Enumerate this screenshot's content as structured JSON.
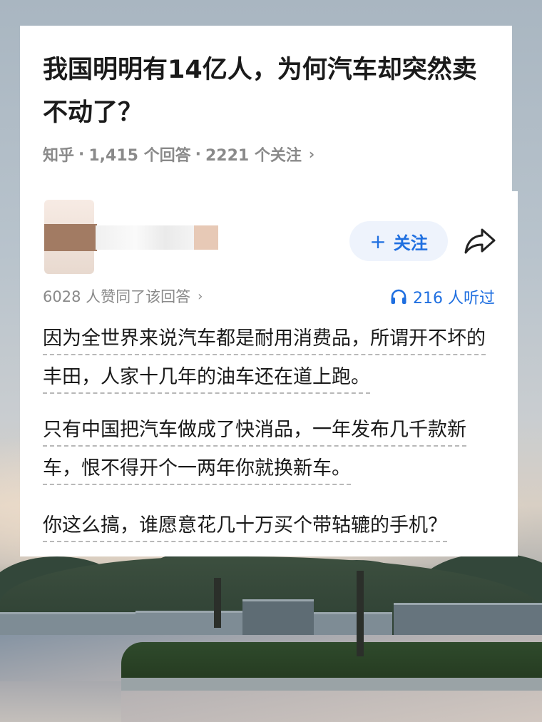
{
  "question": {
    "title": "我国明明有14亿人，为何汽车却突然卖不动了？",
    "source": "知乎",
    "answers": "1,415 个回答",
    "followers": "2221 个关注",
    "chevron": "›"
  },
  "author": {
    "follow_label": "关注",
    "follow_plus": "+",
    "share_icon": "share-icon"
  },
  "stats": {
    "likes": "6028 人赞同了该回答",
    "likes_chevron": "›",
    "listens": "216 人听过",
    "listen_icon": "headphones-icon"
  },
  "answer": {
    "paragraphs": [
      "因为全世界来说汽车都是耐用消费品，所谓开不坏的丰田，人家十几年的油车还在道上跑。",
      "只有中国把汽车做成了快消品，一年发布几千款新车，恨不得开个一两年你就换新车。",
      "你这么搞，谁愿意花几十万买个带轱辘的手机？"
    ]
  },
  "colors": {
    "accent": "#1f6fe0",
    "meta_gray": "#8a8a8a",
    "text": "#1a1a1a"
  }
}
